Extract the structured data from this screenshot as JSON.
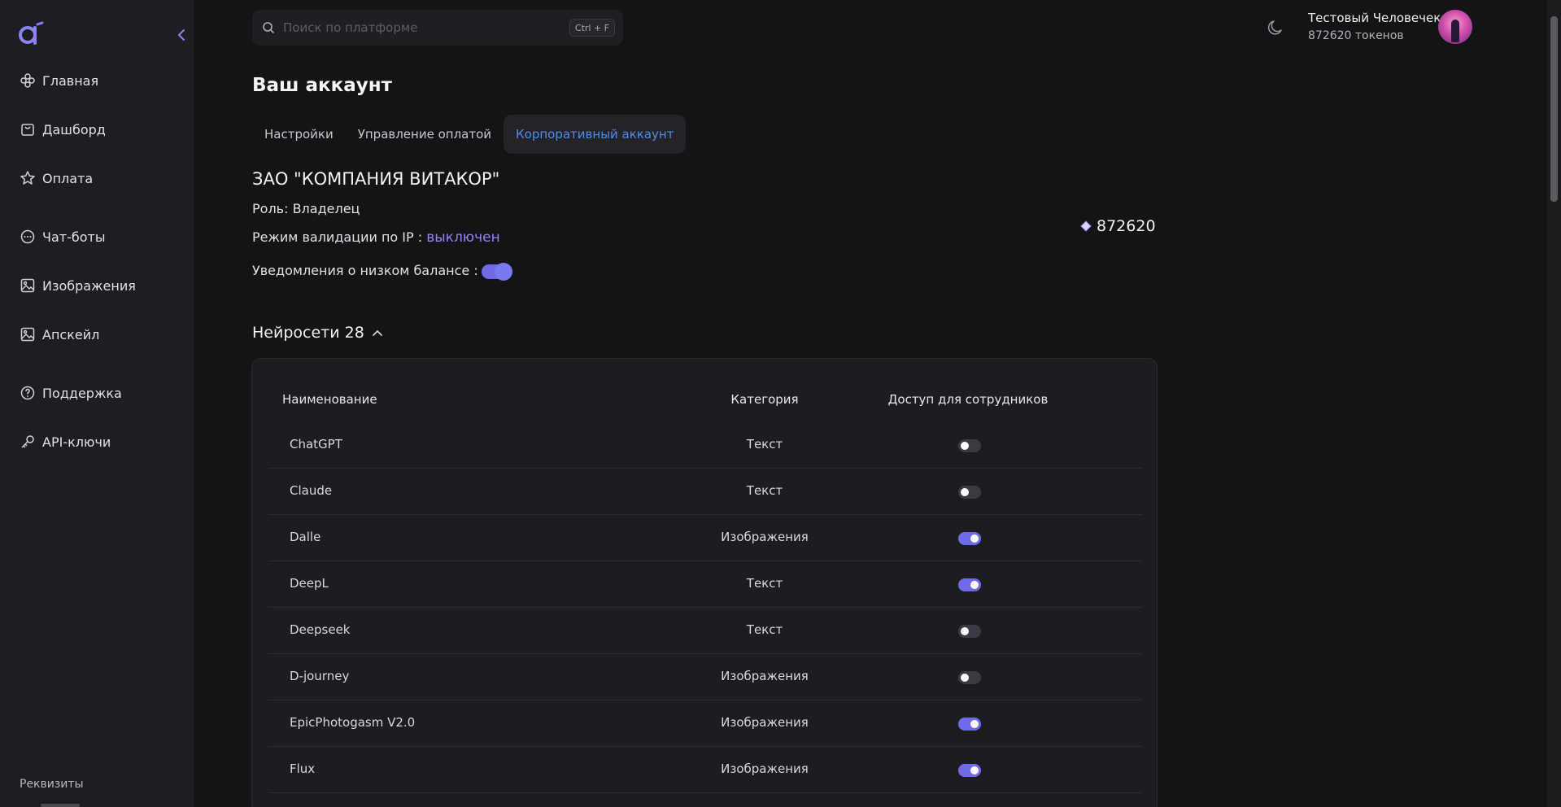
{
  "sidebar": {
    "items": [
      {
        "label": "Главная",
        "icon": "home-icon"
      },
      {
        "label": "Дашборд",
        "icon": "dashboard-icon"
      },
      {
        "label": "Оплата",
        "icon": "star-icon"
      },
      {
        "label": "Чат-боты",
        "icon": "chat-icon"
      },
      {
        "label": "Изображения",
        "icon": "image-icon"
      },
      {
        "label": "Апскейл",
        "icon": "upscale-icon"
      },
      {
        "label": "Поддержка",
        "icon": "help-icon"
      },
      {
        "label": "API-ключи",
        "icon": "key-icon"
      }
    ],
    "footer": "Реквизиты"
  },
  "search": {
    "placeholder": "Поиск по платформе",
    "shortcut": "Ctrl + F"
  },
  "user": {
    "name": "Тестовый Человечек",
    "tokens": "872620 токенов"
  },
  "page": {
    "title": "Ваш аккаунт",
    "tabs": [
      {
        "label": "Настройки",
        "active": false
      },
      {
        "label": "Управление оплатой",
        "active": false
      },
      {
        "label": "Корпоративный аккаунт",
        "active": true
      }
    ]
  },
  "company": {
    "name": "ЗАО \"КОМПАНИЯ ВИТАКОР\"",
    "role": "Роль: Владелец",
    "ip_label": "Режим валидации по IP :",
    "ip_value": "выключен",
    "low_balance_label": "Уведомления о низком балансе :",
    "low_balance_on": true,
    "balance": "872620"
  },
  "models": {
    "title": "Нейросети 28",
    "columns": [
      "Наименование",
      "Категория",
      "Доступ для сотрудников"
    ],
    "rows": [
      {
        "name": "ChatGPT",
        "category": "Текст",
        "access": false
      },
      {
        "name": "Claude",
        "category": "Текст",
        "access": false
      },
      {
        "name": "Dalle",
        "category": "Изображения",
        "access": true
      },
      {
        "name": "DeepL",
        "category": "Текст",
        "access": true
      },
      {
        "name": "Deepseek",
        "category": "Текст",
        "access": false
      },
      {
        "name": "D-journey",
        "category": "Изображения",
        "access": false
      },
      {
        "name": "EpicPhotogasm V2.0",
        "category": "Изображения",
        "access": true
      },
      {
        "name": "Flux",
        "category": "Изображения",
        "access": true
      }
    ]
  },
  "colors": {
    "accent": "#6f6ae8",
    "link": "#8e87f5",
    "tab_active": "#4d8ef0"
  }
}
